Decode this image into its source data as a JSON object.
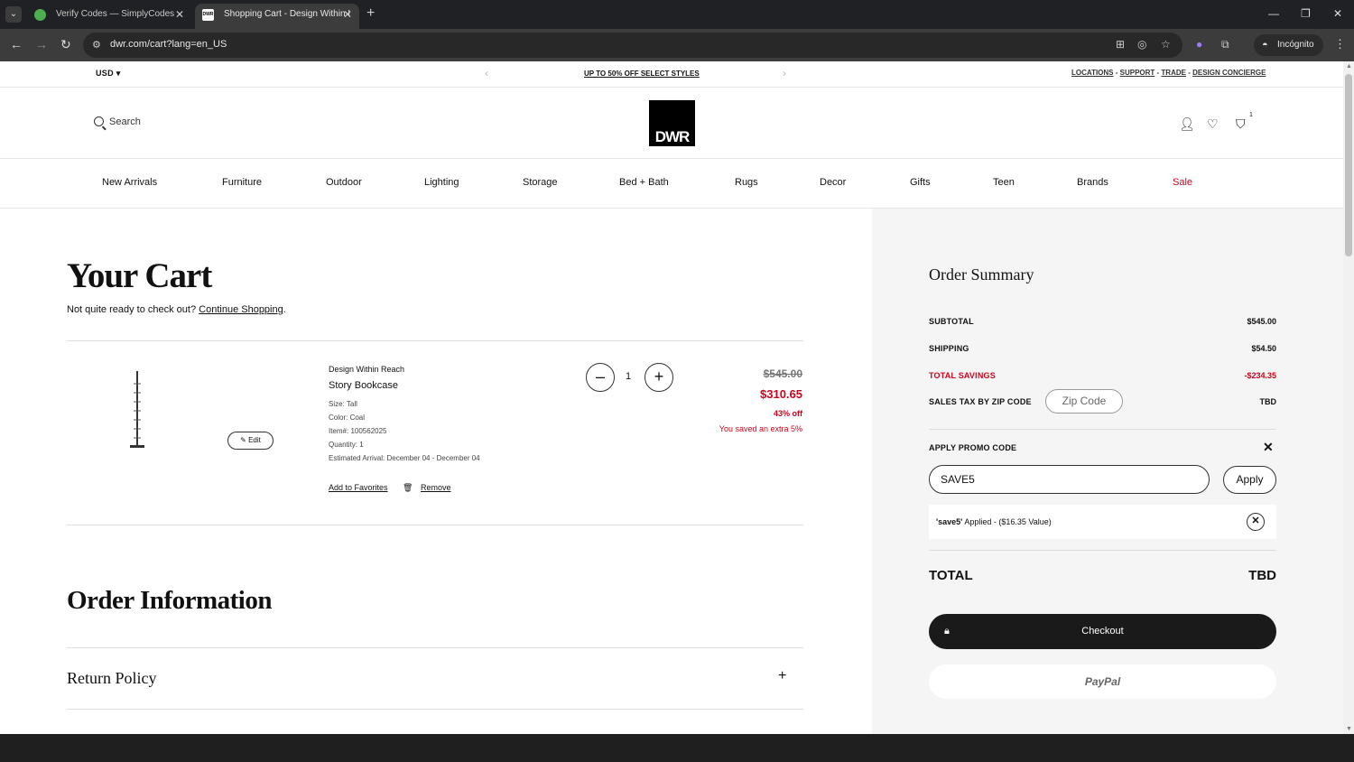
{
  "browser": {
    "tabs": [
      {
        "title": "Verify Codes — SimplyCodes"
      },
      {
        "title": "Shopping Cart - Design Within I",
        "favicon_text": "DWR"
      }
    ],
    "url": "dwr.com/cart?lang=en_US",
    "profile_label": "Incógnito"
  },
  "utility": {
    "currency": "USD",
    "promo_text": "UP TO 50% OFF SELECT STYLES",
    "links": [
      "LOCATIONS",
      "SUPPORT",
      "TRADE",
      "DESIGN CONCIERGE"
    ],
    "separator": " - "
  },
  "header": {
    "search_label": "Search",
    "logo_text": "DWR",
    "cart_count": "1"
  },
  "nav": [
    "New Arrivals",
    "Furniture",
    "Outdoor",
    "Lighting",
    "Storage",
    "Bed + Bath",
    "Rugs",
    "Decor",
    "Gifts",
    "Teen",
    "Brands",
    "Sale"
  ],
  "cart": {
    "title": "Your Cart",
    "subtitle_prefix": "Not quite ready to check out? ",
    "continue_link": "Continue Shopping",
    "subtitle_suffix": ".",
    "item": {
      "brand": "Design Within Reach",
      "name": "Story Bookcase",
      "size": "Size: Tall",
      "color": "Color: Coal",
      "item_no": "Item#: 100562025",
      "quantity_line": "Quantity: 1",
      "arrival": "Estimated Arrival: December 04 - December 04",
      "edit_label": "Edit",
      "favorites_label": "Add to Favorites",
      "remove_label": "Remove",
      "quantity": "1",
      "price_was": "$545.00",
      "price_now": "$310.65",
      "pct_off": "43% off",
      "extra_saved": "You saved an extra 5%"
    },
    "order_info_title": "Order Information",
    "return_policy": "Return Policy"
  },
  "summary": {
    "title": "Order Summary",
    "rows": [
      {
        "label": "SUBTOTAL",
        "value": "$545.00"
      },
      {
        "label": "SHIPPING",
        "value": "$54.50"
      },
      {
        "label": "TOTAL SAVINGS",
        "value": "-$234.35"
      },
      {
        "label": "SALES TAX BY ZIP CODE",
        "value": "TBD"
      }
    ],
    "zip_placeholder": "Zip Code",
    "promo_label": "APPLY PROMO CODE",
    "promo_value": "SAVE5",
    "apply_label": "Apply",
    "applied_code": "'save5'",
    "applied_text": " Applied - ($16.35 Value)",
    "total_label": "TOTAL",
    "total_value": "TBD",
    "checkout_label": "Checkout",
    "paypal_label": "PayPal"
  },
  "colors": {
    "sale_red": "#d0021b",
    "checkout_bg": "#1a1a1a",
    "summary_bg": "#f5f5f5"
  }
}
